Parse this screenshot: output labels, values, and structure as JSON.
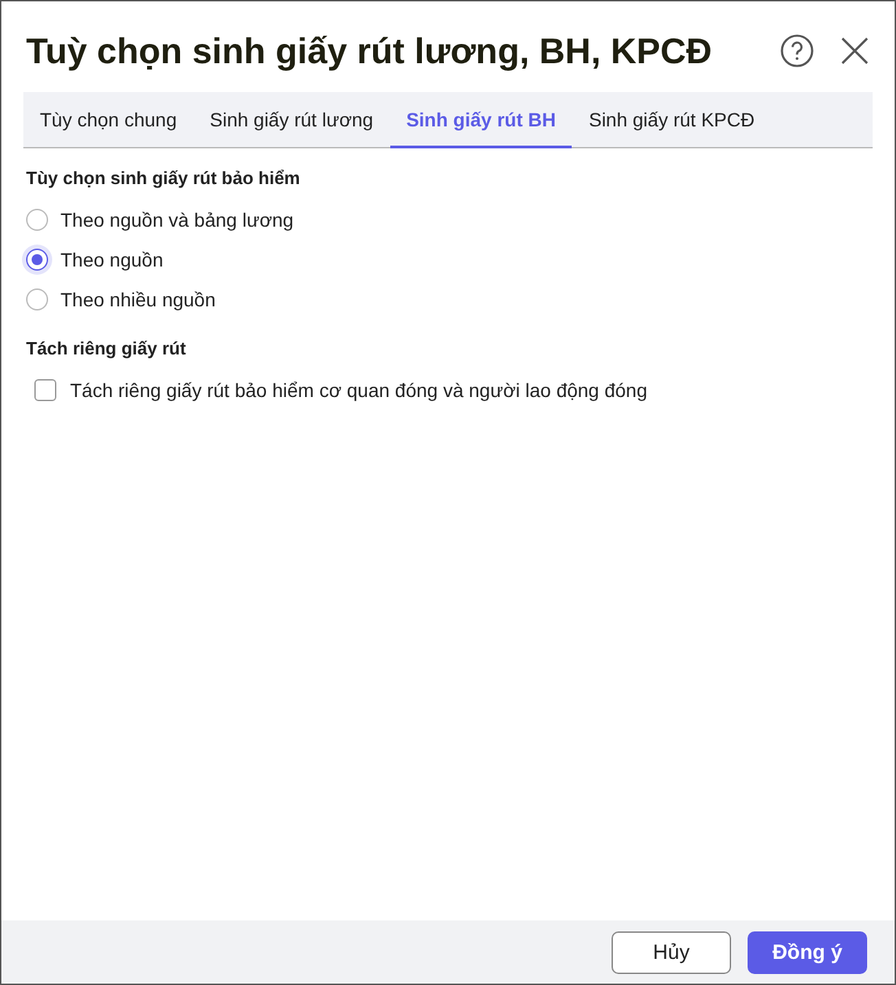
{
  "window": {
    "title": "Tuỳ chọn sinh giấy rút lương, BH, KPCĐ"
  },
  "tabs": [
    {
      "label": "Tùy chọn chung",
      "selected": false
    },
    {
      "label": "Sinh giấy rút lương",
      "selected": false
    },
    {
      "label": "Sinh giấy rút BH",
      "selected": true
    },
    {
      "label": "Sinh giấy rút KPCĐ",
      "selected": false
    }
  ],
  "sections": [
    {
      "heading": "Tùy chọn sinh giấy rút bảo hiểm",
      "kind": "radio",
      "options": [
        {
          "label": "Theo nguồn và bảng lương",
          "selected": false
        },
        {
          "label": "Theo nguồn",
          "selected": true
        },
        {
          "label": "Theo nhiều nguồn",
          "selected": false
        }
      ]
    },
    {
      "heading": "Tách riêng giấy rút",
      "kind": "checkbox",
      "options": [
        {
          "label": "Tách riêng giấy rút bảo hiểm cơ quan đóng và người lao động đóng",
          "checked": false
        }
      ]
    }
  ],
  "buttons": [
    {
      "label": "Hủy",
      "kind": "secondary"
    },
    {
      "label": "Đồng ý",
      "kind": "primary"
    }
  ]
}
